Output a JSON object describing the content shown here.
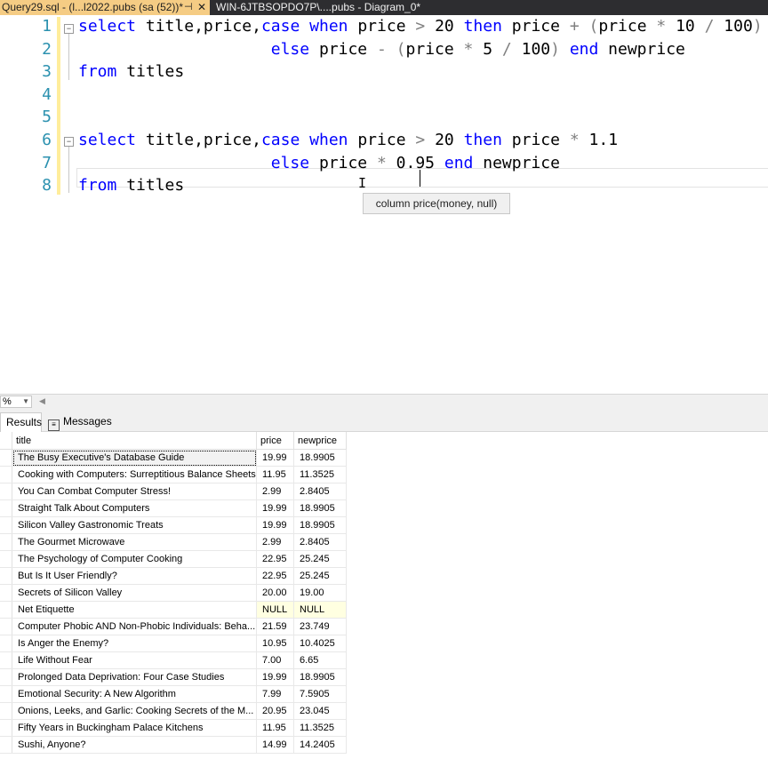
{
  "tabs": {
    "active": "Query29.sql - (l...l2022.pubs (sa (52))*",
    "active_pin": "⊣",
    "active_close": "✕",
    "inactive": "WIN-6JTBSOPDO7P\\....pubs - Diagram_0*"
  },
  "editor": {
    "line_numbers": [
      "1",
      "2",
      "3",
      "4",
      "5",
      "6",
      "7",
      "8"
    ],
    "lines": [
      "select title,price,case when price > 20 then price + (price * 10 / 100)",
      "                    else price - (price * 5 / 100) end newprice",
      "from titles",
      "",
      "",
      "select title,price,case when price > 20 then price * 1.1",
      "                    else price * 0.95 end newprice",
      "from titles"
    ],
    "tooltip": "column price(money, null)"
  },
  "zoom": {
    "value": "%"
  },
  "results_tabs": {
    "results": "Results",
    "messages": "Messages"
  },
  "grid": {
    "columns": [
      "title",
      "price",
      "newprice"
    ],
    "rows": [
      [
        "The Busy Executive's Database Guide",
        "19.99",
        "18.9905"
      ],
      [
        "Cooking with Computers: Surreptitious Balance Sheets",
        "11.95",
        "11.3525"
      ],
      [
        "You Can Combat Computer Stress!",
        "2.99",
        "2.8405"
      ],
      [
        "Straight Talk About Computers",
        "19.99",
        "18.9905"
      ],
      [
        "Silicon Valley Gastronomic Treats",
        "19.99",
        "18.9905"
      ],
      [
        "The Gourmet Microwave",
        "2.99",
        "2.8405"
      ],
      [
        "The Psychology of Computer Cooking",
        "22.95",
        "25.245"
      ],
      [
        "But Is It User Friendly?",
        "22.95",
        "25.245"
      ],
      [
        "Secrets of Silicon Valley",
        "20.00",
        "19.00"
      ],
      [
        "Net Etiquette",
        "NULL",
        "NULL"
      ],
      [
        "Computer Phobic AND Non-Phobic Individuals: Beha...",
        "21.59",
        "23.749"
      ],
      [
        "Is Anger the Enemy?",
        "10.95",
        "10.4025"
      ],
      [
        "Life Without Fear",
        "7.00",
        "6.65"
      ],
      [
        "Prolonged Data Deprivation: Four Case Studies",
        "19.99",
        "18.9905"
      ],
      [
        "Emotional Security: A New Algorithm",
        "7.99",
        "7.5905"
      ],
      [
        "Onions, Leeks, and Garlic: Cooking Secrets of the M...",
        "20.95",
        "23.045"
      ],
      [
        "Fifty Years in Buckingham Palace Kitchens",
        "11.95",
        "11.3525"
      ],
      [
        "Sushi, Anyone?",
        "14.99",
        "14.2405"
      ]
    ]
  },
  "colors": {
    "keyword": "#0000ff",
    "operator": "#808080",
    "line_number": "#2b91af",
    "active_tab": "#f5cc84",
    "null_cell": "#ffffe1"
  }
}
